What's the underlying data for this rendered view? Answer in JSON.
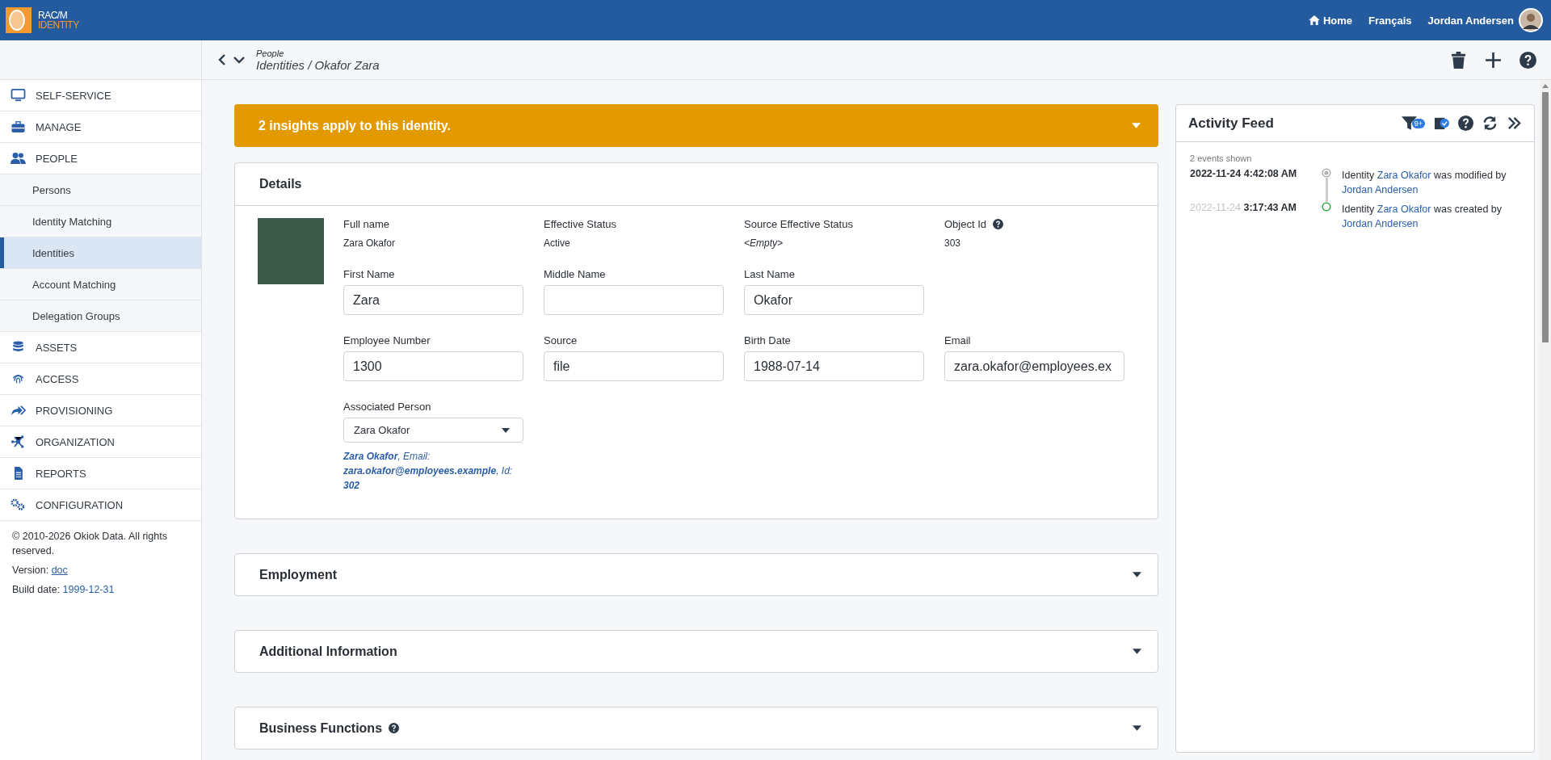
{
  "header": {
    "logo_top": "RAC/M",
    "logo_bottom": "IDENTITY",
    "home": "Home",
    "language": "Français",
    "user": "Jordan Andersen"
  },
  "breadcrumb": {
    "parent": "People",
    "path": "Identities / Okafor Zara"
  },
  "sidebar": {
    "items": [
      {
        "label": "SELF-SERVICE"
      },
      {
        "label": "MANAGE"
      },
      {
        "label": "PEOPLE",
        "children": [
          {
            "label": "Persons",
            "selected": false
          },
          {
            "label": "Identity Matching",
            "selected": false
          },
          {
            "label": "Identities",
            "selected": true
          },
          {
            "label": "Account Matching",
            "selected": false
          },
          {
            "label": "Delegation Groups",
            "selected": false
          }
        ]
      },
      {
        "label": "ASSETS"
      },
      {
        "label": "ACCESS"
      },
      {
        "label": "PROVISIONING"
      },
      {
        "label": "ORGANIZATION"
      },
      {
        "label": "REPORTS"
      },
      {
        "label": "CONFIGURATION"
      }
    ],
    "footer": {
      "copyright": "© 2010-2026 Okiok Data. All rights reserved.",
      "version_label": "Version:",
      "version": "doc",
      "build_label": "Build date:",
      "build_date": "1999-12-31"
    }
  },
  "insight_banner": {
    "text": "2 insights apply to this identity.",
    "expanded": false
  },
  "details": {
    "title": "Details",
    "info": [
      {
        "label": "Full name",
        "value": "Zara Okafor",
        "kind": "plain",
        "help": false
      },
      {
        "label": "Effective Status",
        "value": "Active",
        "kind": "plain",
        "help": false
      },
      {
        "label": "Source Effective Status",
        "value": "<Empty>",
        "kind": "empty",
        "help": false
      },
      {
        "label": "Object Id",
        "value": "303",
        "kind": "plain",
        "help": true
      }
    ],
    "fields": [
      {
        "label": "First Name",
        "value": "Zara",
        "kind": "text"
      },
      {
        "label": "Middle Name",
        "kind": "text"
      },
      {
        "label": "Last Name",
        "value": "Okafor",
        "kind": "text"
      },
      {
        "kind": "gap"
      },
      {
        "label": "Employee Number",
        "value": "1300",
        "kind": "text"
      },
      {
        "label": "Source",
        "value": "file",
        "kind": "text"
      },
      {
        "label": "Birth Date",
        "value": "1988-07-14",
        "kind": "text"
      },
      {
        "label": "Email",
        "value": "zara.okafor@employees.ex",
        "kind": "text"
      },
      {
        "label": "Associated Person",
        "value": "Zara Okafor",
        "kind": "select",
        "note": "**Zara Okafor**, Email: **zara.okafor@employees.example**, Id: **302**"
      }
    ]
  },
  "sections": [
    {
      "title": "Employment",
      "help": false,
      "expanded": false
    },
    {
      "title": "Additional Information",
      "help": false,
      "expanded": false
    },
    {
      "title": "Business Functions",
      "help": true,
      "expanded": false
    }
  ],
  "activity_feed": {
    "title": "Activity Feed",
    "filter_badge": "9+",
    "count": "2 events shown",
    "events": [
      {
        "kind": "modified",
        "date": "2022-11-24",
        "time": "4:42:08 AM",
        "prefix": "Identity",
        "subject": "Zara Okafor",
        "verb": "was modified by",
        "actor": "Jordan Andersen"
      },
      {
        "kind": "created",
        "date": "2022-11-24",
        "time": "3:17:43 AM",
        "prefix": "Identity",
        "subject": "Zara Okafor",
        "verb": "was created by",
        "actor": "Jordan Andersen"
      }
    ]
  }
}
